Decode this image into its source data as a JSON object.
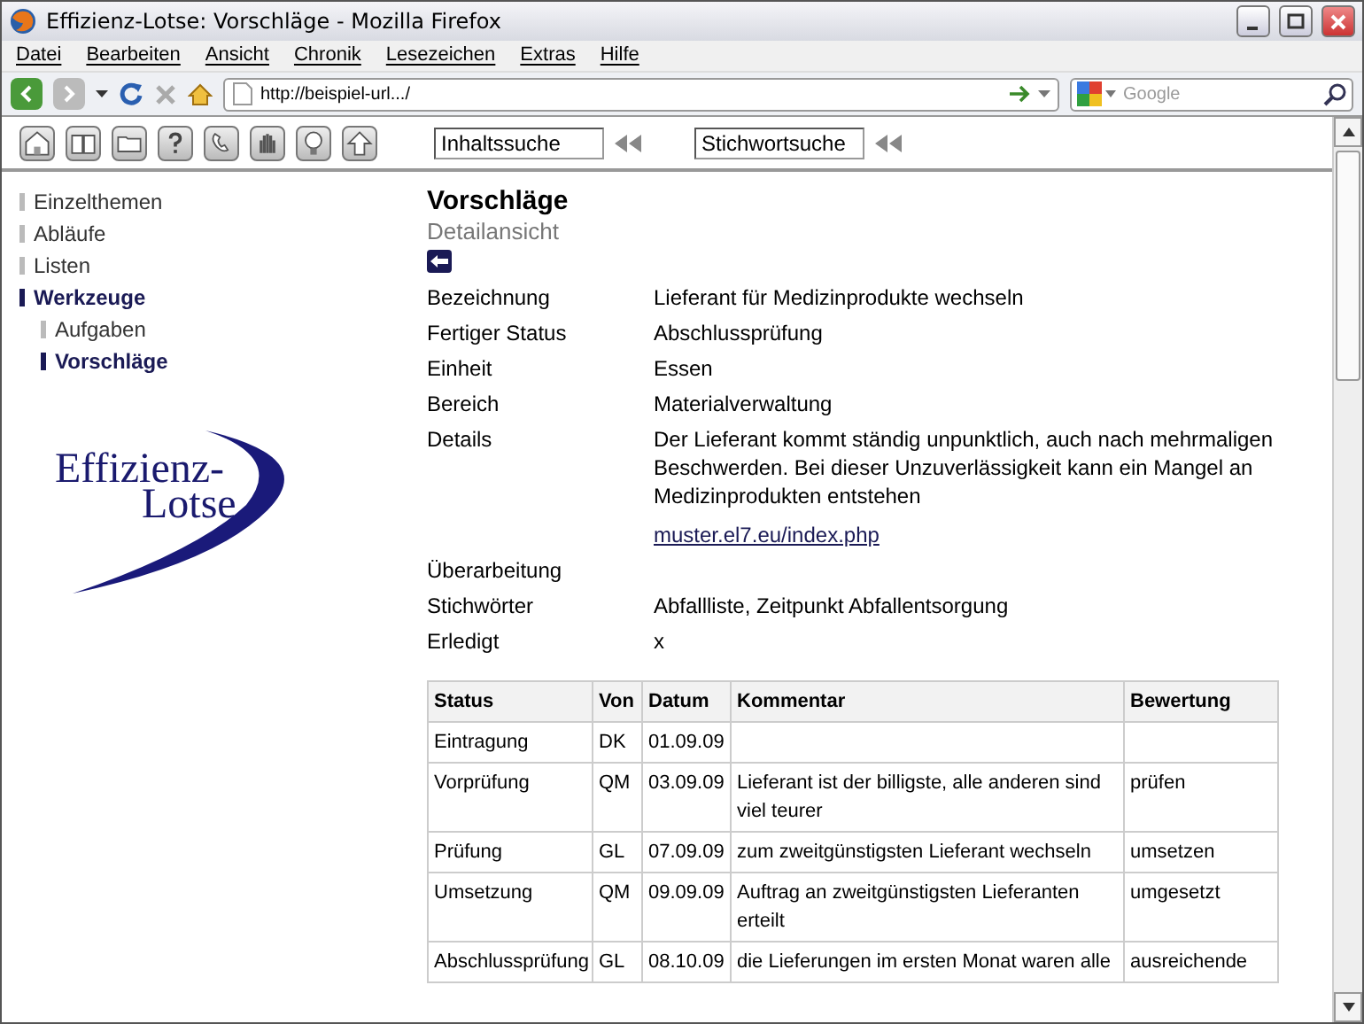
{
  "window": {
    "title": "Effizienz-Lotse: Vorschläge - Mozilla Firefox"
  },
  "menu_bar": [
    "Datei",
    "Bearbeiten",
    "Ansicht",
    "Chronik",
    "Lesezeichen",
    "Extras",
    "Hilfe"
  ],
  "navigation": {
    "address": "http://beispiel-url.../",
    "search_placeholder": "Google"
  },
  "page_toolbar": {
    "searches": [
      {
        "value": "Inhaltssuche"
      },
      {
        "value": "Stichwortsuche"
      }
    ]
  },
  "sidebar": {
    "items": [
      {
        "label": "Einzelthemen",
        "selected": false
      },
      {
        "label": "Abläufe",
        "selected": false
      },
      {
        "label": "Listen",
        "selected": false
      },
      {
        "label": "Werkzeuge",
        "selected": true,
        "children": [
          {
            "label": "Aufgaben",
            "selected": false
          },
          {
            "label": "Vorschläge",
            "selected": true
          }
        ]
      }
    ],
    "logo": {
      "line_1": "Effizienz-",
      "line_2": "Lotse"
    }
  },
  "content": {
    "heading": "Vorschläge",
    "subheading": "Detailansicht",
    "fields": [
      {
        "label": "Bezeichnung",
        "value": "Lieferant für Medizinprodukte wechseln"
      },
      {
        "label": "Fertiger Status",
        "value": "Abschlussprüfung"
      },
      {
        "label": "Einheit",
        "value": "Essen"
      },
      {
        "label": "Bereich",
        "value": "Materialverwaltung"
      },
      {
        "label": "Details",
        "value": "Der Lieferant kommt ständig unpunktlich, auch nach mehrmaligen Beschwerden. Bei dieser Unzuverlässigkeit kann ein Mangel an Medizinprodukten entstehen",
        "link": "muster.el7.eu/index.php"
      },
      {
        "label": "Überarbeitung"
      },
      {
        "label": "Stichwörter",
        "value": "Abfallliste, Zeitpunkt Abfallentsorgung"
      },
      {
        "label": "Erledigt",
        "value": "x"
      }
    ],
    "table": {
      "columns": [
        "Status",
        "Von",
        "Datum",
        "Kommentar",
        "Bewertung"
      ],
      "rows": [
        [
          "Eintragung",
          "DK",
          "01.09.09",
          "",
          ""
        ],
        [
          "Vorprüfung",
          "QM",
          "03.09.09",
          "Lieferant ist der billigste, alle anderen sind viel teurer",
          "prüfen"
        ],
        [
          "Prüfung",
          "GL",
          "07.09.09",
          "zum zweitgünstigsten Lieferant wechseln",
          "umsetzen"
        ],
        [
          "Umsetzung",
          "QM",
          "09.09.09",
          "Auftrag an zweitgünstigsten Lieferanten erteilt",
          "umgesetzt"
        ],
        [
          "Abschlussprüfung",
          "GL",
          "08.10.09",
          "die Lieferungen im ersten Monat waren alle",
          "ausreichende"
        ]
      ]
    }
  }
}
